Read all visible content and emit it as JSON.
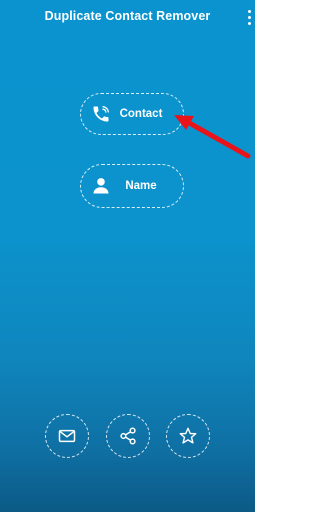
{
  "app": {
    "title": "Duplicate Contact Remover",
    "menu_icon": "more-vert-icon"
  },
  "main": {
    "buttons": [
      {
        "label": "Contact",
        "icon": "phone-call-icon"
      },
      {
        "label": "Name",
        "icon": "person-icon"
      }
    ]
  },
  "footer": {
    "actions": [
      {
        "icon": "mail-icon"
      },
      {
        "icon": "share-icon"
      },
      {
        "icon": "star-icon"
      }
    ]
  },
  "colors": {
    "background_top": "#0a93cf",
    "background_bottom": "#0c5a86",
    "annotation_arrow": "#e8141a",
    "foreground": "#ffffff"
  }
}
